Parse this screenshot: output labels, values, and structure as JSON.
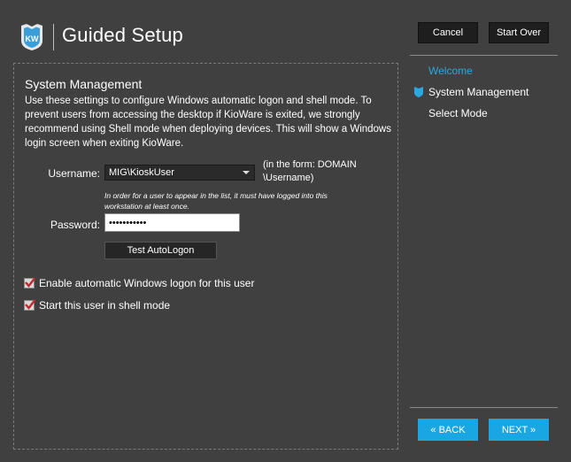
{
  "header": {
    "logo_text": "KW",
    "title": "Guided Setup",
    "cancel_label": "Cancel",
    "start_over_label": "Start Over"
  },
  "section": {
    "title": "System Management",
    "description": "Use these settings to configure Windows automatic logon and shell mode. To prevent users from accessing the desktop if KioWare is exited, we strongly recommend using Shell mode when deploying devices. This will show a Windows login screen when exiting KioWare."
  },
  "form": {
    "username_label": "Username:",
    "username_value": "MIG\\KioskUser",
    "username_hint": "(in the form: DOMAIN \\Username)",
    "username_note": "In order for a user to appear in the list, it must have logged into this workstation at least once.",
    "password_label": "Password:",
    "password_value": "•••••••••••",
    "test_button_label": "Test AutoLogon"
  },
  "options": [
    {
      "label": "Enable automatic Windows logon for this user",
      "checked": true
    },
    {
      "label": "Start this user in shell mode",
      "checked": true
    }
  ],
  "steps": [
    {
      "label": "Welcome",
      "state": "completed"
    },
    {
      "label": "System Management",
      "state": "current"
    },
    {
      "label": "Select Mode",
      "state": "pending"
    }
  ],
  "footer": {
    "back_label": "« BACK",
    "next_label": "NEXT »"
  },
  "colors": {
    "background": "#404040",
    "accent": "#1aa6e3",
    "active_step": "#29a9e0",
    "checkmark": "#c0282d"
  }
}
